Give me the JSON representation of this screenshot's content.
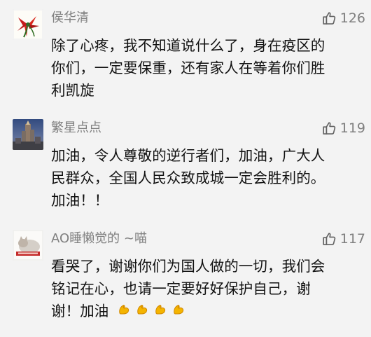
{
  "comments": [
    {
      "username": "侯华清",
      "likes": "126",
      "lines": [
        "除了心疼，我不知道说什么了，身在疫区的",
        "你们，一定要保重，还有家人在等着你们胜",
        "利凯旋"
      ],
      "avatar_icon": "red-plant-avatar-icon"
    },
    {
      "username": "繁星点点",
      "likes": "119",
      "lines": [
        "加油，令人尊敬的逆行者们，加油，广大人",
        "民群众，全国人民众致成城一定会胜利的。",
        "加油！！"
      ],
      "avatar_icon": "city-night-avatar-icon"
    },
    {
      "username": "AO睡懒觉的 ~喵",
      "likes": "117",
      "lines": [
        "看哭了，谢谢你们为国人做的一切，我们会",
        "铭记在心，也请一定要好好保护自己，谢",
        "谢！加油"
      ],
      "emoji": "💪💪💪💪",
      "avatar_icon": "cat-photo-avatar-icon"
    }
  ]
}
